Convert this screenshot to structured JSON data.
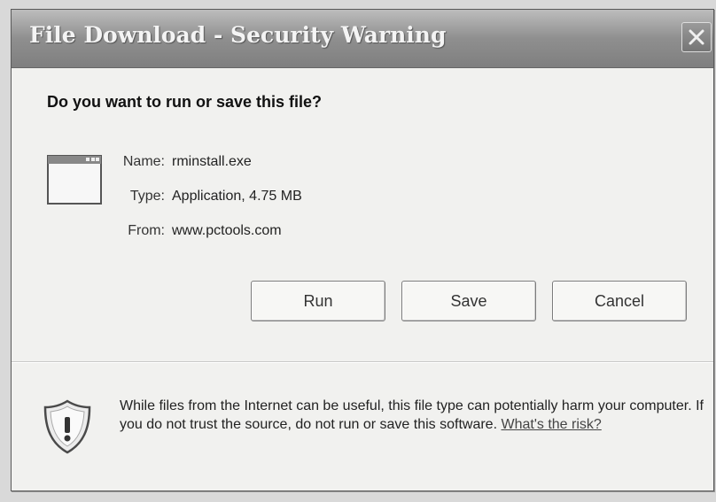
{
  "window": {
    "title": "File Download - Security Warning"
  },
  "dialog": {
    "question": "Do you want to run or save this file?",
    "file": {
      "name_label": "Name:",
      "name_value": "rminstall.exe",
      "type_label": "Type:",
      "type_value": "Application, 4.75 MB",
      "from_label": "From:",
      "from_value": "www.pctools.com",
      "icon": "application-window-icon"
    },
    "buttons": {
      "run": "Run",
      "save": "Save",
      "cancel": "Cancel"
    },
    "warning": {
      "icon": "shield-warning-icon",
      "text": "While files from the Internet can be useful, this file type can potentially harm your computer. If you do not trust the source, do not run or save this software.",
      "link": "What's the risk?"
    }
  }
}
